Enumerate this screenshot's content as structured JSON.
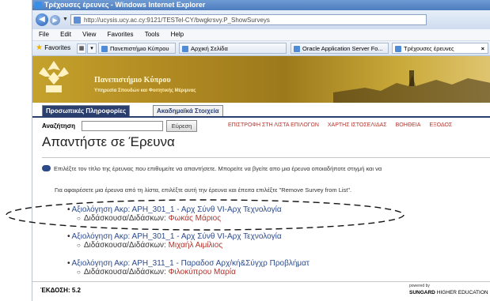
{
  "window": {
    "title": "Τρέχουσες έρευνες - Windows Internet Explorer",
    "address": "http://ucysis.ucy.ac.cy:9121/TESTel-CY/bwgkrsvy.P_ShowSurveys",
    "address_host_bold": "ucy.ac.cy"
  },
  "menu": [
    "File",
    "Edit",
    "View",
    "Favorites",
    "Tools",
    "Help"
  ],
  "favorites": {
    "label": "Favorites",
    "tabs": [
      {
        "label": "Πανεπιστήμιο Κύπρου"
      },
      {
        "label": "Αρχική Σελίδα"
      },
      {
        "label": "Oracle Application Server Fo..."
      },
      {
        "label": "Τρέχουσες έρευνες"
      }
    ],
    "close": "×"
  },
  "banner": {
    "university": "Πανεπιστήμιο Κύπρου",
    "department": "Υπηρεσία Σπουδών και Φοιτητικής Μέριμνας"
  },
  "tabs": {
    "personal": "Προσωπικές Πληροφορίες",
    "academic": "Ακαδημαϊκά Στοιχεία"
  },
  "search": {
    "label": "Αναζήτηση",
    "button": "Εύρεση"
  },
  "nav_links": [
    "ΕΠΙΣΤΡΟΦΗ ΣΤΗ ΛΙΣΤΑ ΕΠΙΛΟΓΩΝ",
    "ΧΑΡΤΗΣ ΙΣΤΟΣΕΛΙΔΑΣ",
    "ΒΟΗΘΕΙΑ",
    "ΕΞΟΔΟΣ"
  ],
  "page_title": "Απαντήστε σε Έρευνα",
  "info": {
    "line1": "Επιλέξτε τον τίτλο της έρευνας που επιθυμείτε να απαντήσετε.  Μπορείτε να βγείτε απο μια έρευνα οποιαδήποτε στιγμή και να",
    "line2": "Για αφαιρέσετε μια έρευνα από τη λίστα, επιλέξτε αυτή την έρευνα και έπειτα επιλέξτε \"Remove Survey from List\"."
  },
  "instructor_label": "Διδάσκουσα/Διδάσκων:",
  "surveys": [
    {
      "title": "Αξιολόγηση Ακρ: ΑΡΗ_301_1 - Αρχ Σύνθ VI-Αρχ Τεχνολογία",
      "instructor": "Φωκάς Μάριος"
    },
    {
      "title": "Αξιολόγηση Ακρ: ΑΡΗ_301_1 - Αρχ Σύνθ VI-Αρχ Τεχνολογία",
      "instructor": "Μιχαήλ Αιμίλιος"
    },
    {
      "title": "Αξιολόγηση Ακρ: ΑΡΗ_311_1 - Παραδοσ Αρχ/κή&Σύγχρ Προβλήματ",
      "instructor": "Φιλοκύπρου Μαρία"
    }
  ],
  "footer": {
    "version": "ΈΚΔΟΣΗ: 5.2",
    "powered_by": "powered by",
    "sungard_brand": "SUNGARD",
    "sungard_rest": "HIGHER EDUCATION"
  },
  "colors": {
    "brand_navy": "#2b3f6f",
    "link_red": "#b4322a",
    "link_blue": "#2c4a8a",
    "banner_gold": "#b08921"
  }
}
